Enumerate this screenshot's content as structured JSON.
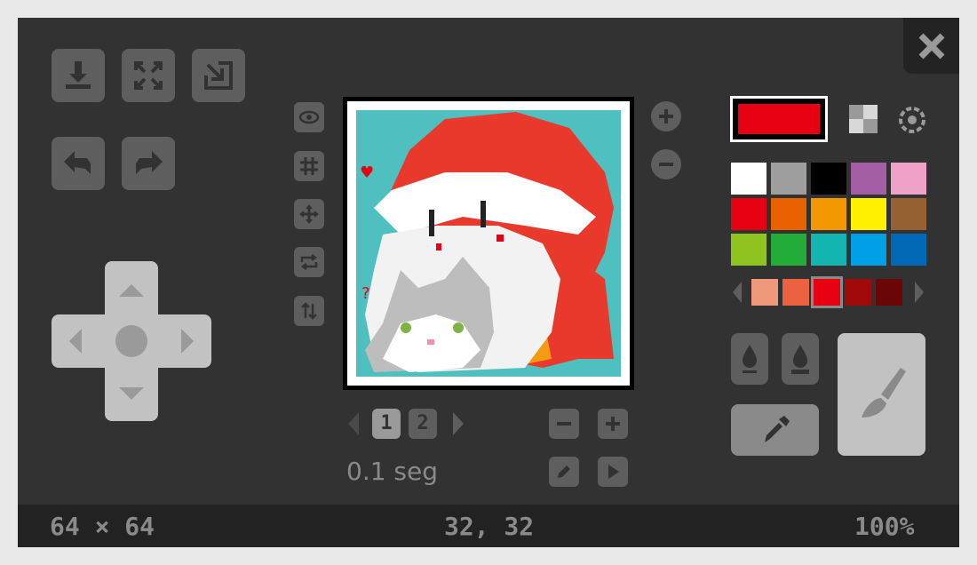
{
  "toolbar": {
    "download_icon": "download-icon",
    "fullscreen_icon": "fullscreen-icon",
    "import_icon": "import-icon",
    "undo_icon": "undo-icon",
    "redo_icon": "redo-icon"
  },
  "close_icon": "close-icon",
  "view_tools": [
    "eye-icon",
    "grid-icon",
    "move-icon",
    "swap-icon",
    "flip-icon"
  ],
  "zoom": {
    "in_icon": "plus-icon",
    "out_icon": "minus-icon"
  },
  "frames": {
    "items": [
      "1",
      "2"
    ],
    "selected": "1",
    "duration": "0.1 seg"
  },
  "palette": {
    "current_color": "#e60012",
    "colors": [
      "#ffffff",
      "#9e9e9e",
      "#000000",
      "#a35ea6",
      "#f0a1c8",
      "#e60012",
      "#ea6100",
      "#f39800",
      "#fff100",
      "#956134",
      "#8fc31f",
      "#22ac38",
      "#13b5b1",
      "#00a0e9",
      "#0068b7"
    ],
    "shades": [
      "#f0987a",
      "#ec6240",
      "#e60012",
      "#a10a0a",
      "#6b0606"
    ],
    "selected_shade_index": 2
  },
  "tools": {
    "fill_icon": "fill-icon",
    "fill_all_icon": "fill-all-icon",
    "eyedropper_icon": "eyedropper-icon",
    "brush_icon": "brush-icon",
    "active": "brush"
  },
  "status": {
    "size": "64 × 64",
    "cursor": "32, 32",
    "zoom": "100%"
  }
}
